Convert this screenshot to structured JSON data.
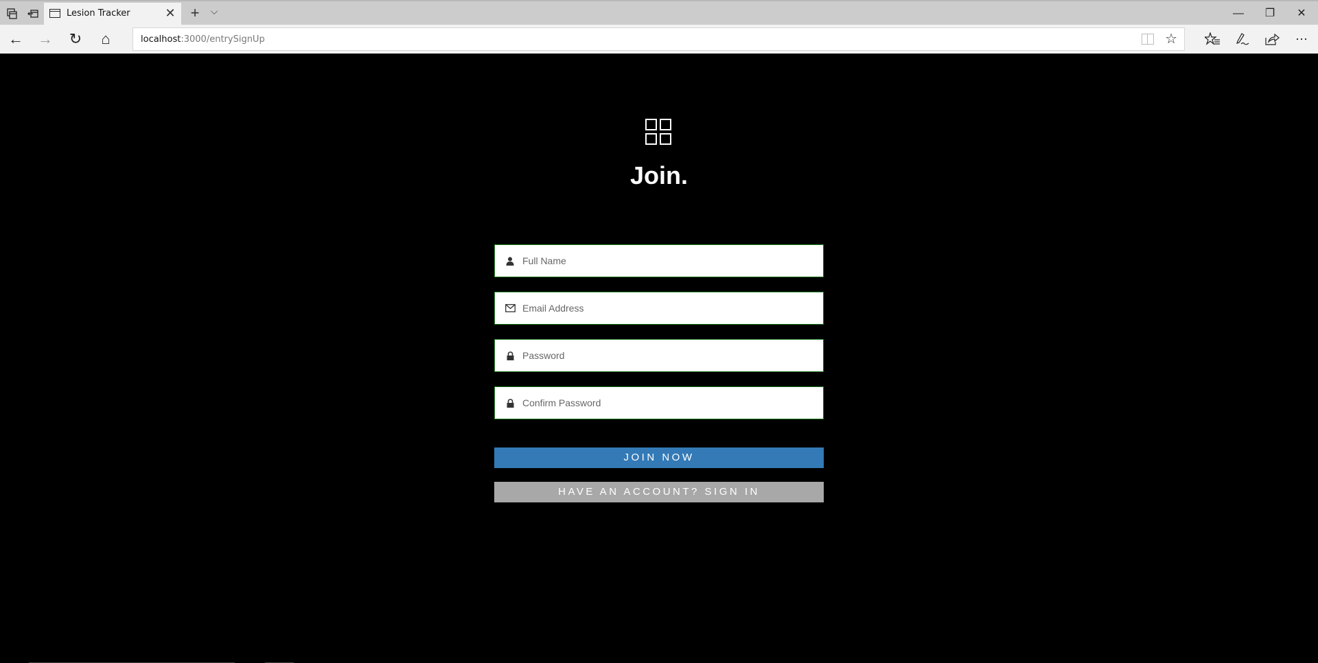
{
  "browser": {
    "tab": {
      "title": "Lesion Tracker"
    },
    "address": {
      "host": "localhost",
      "path": ":3000/entrySignUp"
    },
    "icons": {
      "tab_actions": "tab-actions-icon",
      "set_aside": "set-aside-tabs-icon",
      "new_tab": "+",
      "tab_dropdown": "⌵",
      "back": "←",
      "forward": "→",
      "refresh": "↻",
      "home": "⌂",
      "favorite": "☆",
      "more": "⋯",
      "minimize": "—",
      "restore": "❐",
      "close": "✕"
    }
  },
  "page": {
    "heading": "Join.",
    "fields": [
      {
        "name": "full-name",
        "placeholder": "Full Name",
        "icon": "user-icon",
        "value": ""
      },
      {
        "name": "email",
        "placeholder": "Email Address",
        "icon": "envelope-icon",
        "value": ""
      },
      {
        "name": "password",
        "placeholder": "Password",
        "icon": "lock-icon",
        "value": ""
      },
      {
        "name": "confirm-password",
        "placeholder": "Confirm Password",
        "icon": "lock-icon",
        "value": ""
      }
    ],
    "join_button": "JOIN NOW",
    "signin_button": "HAVE AN ACCOUNT? SIGN IN",
    "colors": {
      "primary": "#337ab7",
      "secondary": "#a8a8a8",
      "field_border": "#1e7e1e",
      "background": "#000000"
    }
  }
}
